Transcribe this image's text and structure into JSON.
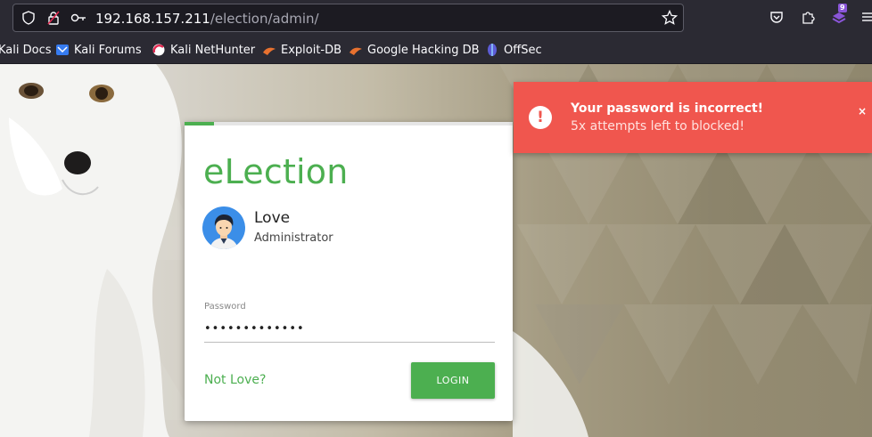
{
  "browser": {
    "url_host": "192.168.157.211",
    "url_path": "/election/admin/",
    "extension_badge": "9",
    "icons": [
      "shield-icon",
      "lock-icon",
      "key-icon",
      "star-icon",
      "pocket-icon",
      "extensions-icon",
      "addon-icon",
      "menu-icon"
    ]
  },
  "bookmarks": [
    {
      "label": "Kali Docs",
      "icon": "kali-icon"
    },
    {
      "label": "Kali Forums",
      "icon": "kali-forums-icon"
    },
    {
      "label": "Kali NetHunter",
      "icon": "nethunter-icon"
    },
    {
      "label": "Exploit-DB",
      "icon": "exploitdb-icon"
    },
    {
      "label": "Google Hacking DB",
      "icon": "ghdb-icon"
    },
    {
      "label": "OffSec",
      "icon": "offsec-icon"
    }
  ],
  "login": {
    "brand": "eLection",
    "user_name": "Love",
    "user_role": "Administrator",
    "password_label": "Password",
    "password_value": "•••••••••••••",
    "switch_user_link": "Not Love?",
    "login_button": "LOGIN",
    "progress_fraction": 0.09
  },
  "toast": {
    "title": "Your password is incorrect!",
    "message": "5x attempts left to blocked!",
    "icon_text": "!",
    "close": "×"
  },
  "colors": {
    "accent": "#4caf50",
    "error": "#f0564e",
    "browser_chrome": "#2b2a33"
  }
}
